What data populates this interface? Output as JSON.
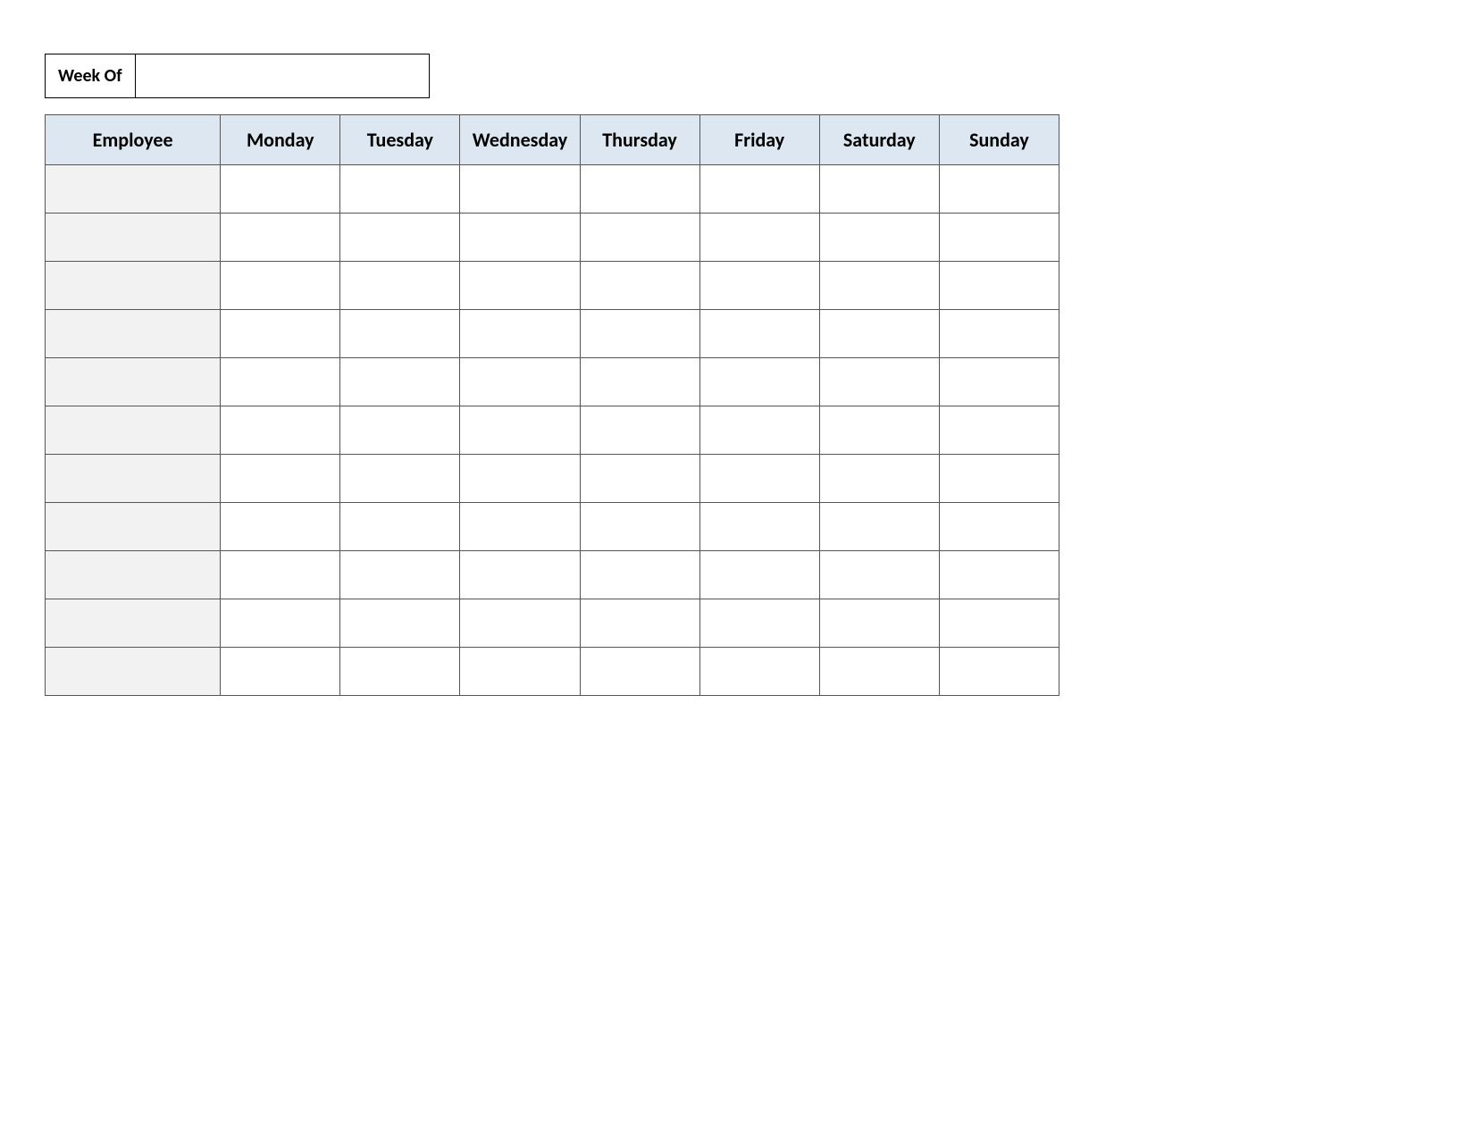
{
  "weekOf": {
    "label": "Week Of",
    "value": ""
  },
  "headers": {
    "employee": "Employee",
    "days": [
      "Monday",
      "Tuesday",
      "Wednesday",
      "Thursday",
      "Friday",
      "Saturday",
      "Sunday"
    ]
  },
  "rows": [
    {
      "employee": "",
      "cells": [
        "",
        "",
        "",
        "",
        "",
        "",
        ""
      ]
    },
    {
      "employee": "",
      "cells": [
        "",
        "",
        "",
        "",
        "",
        "",
        ""
      ]
    },
    {
      "employee": "",
      "cells": [
        "",
        "",
        "",
        "",
        "",
        "",
        ""
      ]
    },
    {
      "employee": "",
      "cells": [
        "",
        "",
        "",
        "",
        "",
        "",
        ""
      ]
    },
    {
      "employee": "",
      "cells": [
        "",
        "",
        "",
        "",
        "",
        "",
        ""
      ]
    },
    {
      "employee": "",
      "cells": [
        "",
        "",
        "",
        "",
        "",
        "",
        ""
      ]
    },
    {
      "employee": "",
      "cells": [
        "",
        "",
        "",
        "",
        "",
        "",
        ""
      ]
    },
    {
      "employee": "",
      "cells": [
        "",
        "",
        "",
        "",
        "",
        "",
        ""
      ]
    },
    {
      "employee": "",
      "cells": [
        "",
        "",
        "",
        "",
        "",
        "",
        ""
      ]
    },
    {
      "employee": "",
      "cells": [
        "",
        "",
        "",
        "",
        "",
        "",
        ""
      ]
    },
    {
      "employee": "",
      "cells": [
        "",
        "",
        "",
        "",
        "",
        "",
        ""
      ]
    }
  ]
}
